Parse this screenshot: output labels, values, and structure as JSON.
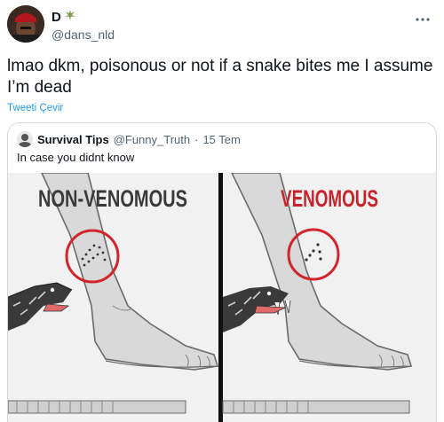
{
  "author": {
    "display_name": "D",
    "username": "@dans_nld"
  },
  "tweet": {
    "text": "lmao dkm, poisonous or not if a snake bites me I assume I’m dead",
    "translate_label": "Tweeti Çevir"
  },
  "quote": {
    "display_name": "Survival Tips",
    "username": "@Funny_Truth",
    "separator": "·",
    "date": "15 Tem",
    "text": "In case you didnt know",
    "image": {
      "left_label": "NON-VENOMOUS",
      "right_label": "VENOMOUS",
      "left_label_color": "#3a3a3a",
      "right_label_color": "#c8222a",
      "circle_color": "#d1242b"
    }
  },
  "icons": {
    "more": "more-horizontal-icon",
    "leaf": "leaf-emoji-icon"
  },
  "colors": {
    "link": "#1d9bf0",
    "secondary_text": "#536471",
    "border": "#cfd9de"
  }
}
